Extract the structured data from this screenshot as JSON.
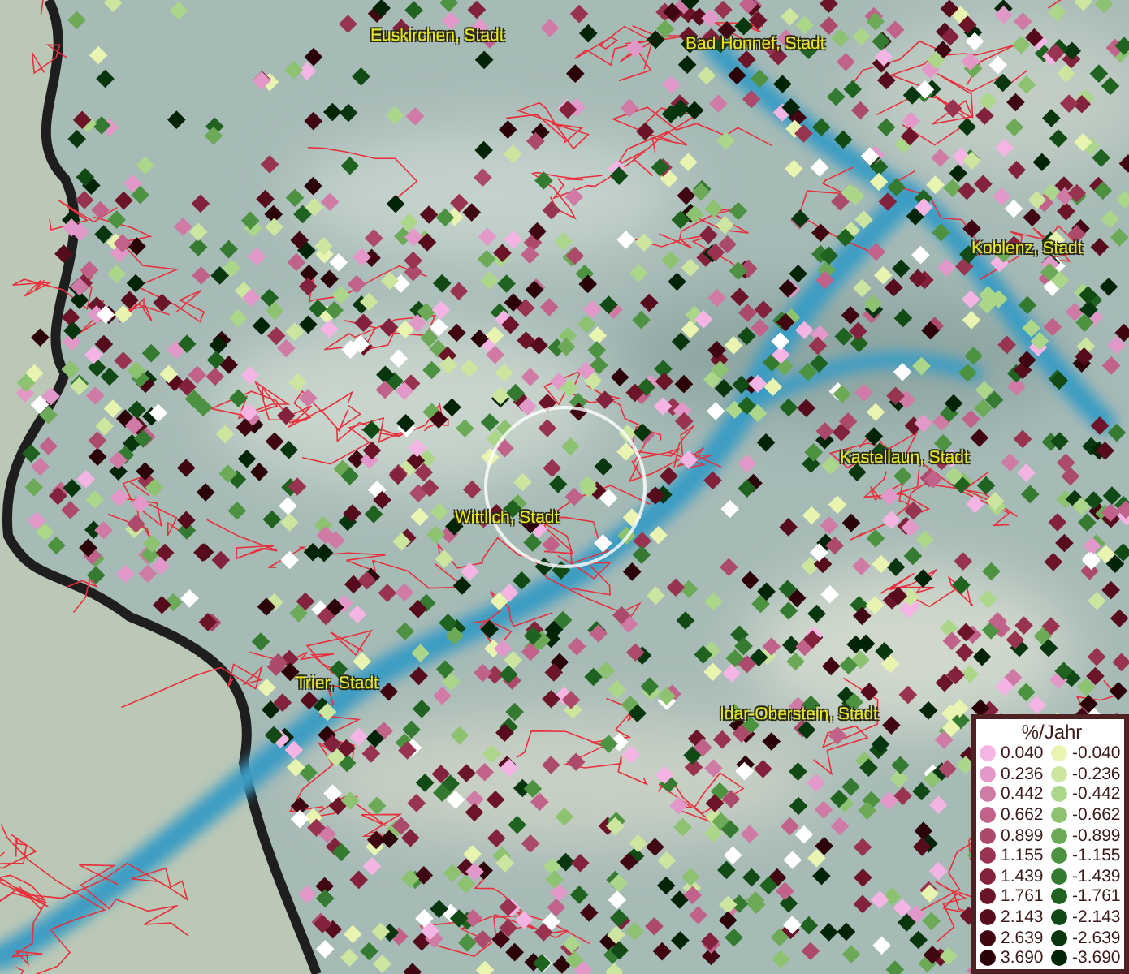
{
  "map": {
    "place_labels": [
      {
        "text": "Euskirchen, Stadt"
      },
      {
        "text": "Bad Honnef, Stadt"
      },
      {
        "text": "Koblenz, Stadt"
      },
      {
        "text": "Kastellaun, Stadt"
      },
      {
        "text": "Wittlich, Stadt"
      },
      {
        "text": "Trier, Stadt"
      },
      {
        "text": "Idar-Oberstein, Stadt"
      }
    ]
  },
  "legend": {
    "title": "%/Jahr",
    "rows": [
      {
        "positive": {
          "label": "0.040",
          "color": "#f4b4e4"
        },
        "negative": {
          "label": "-0.040",
          "color": "#e8f4b0"
        }
      },
      {
        "positive": {
          "label": "0.236",
          "color": "#e298c8"
        },
        "negative": {
          "label": "-0.236",
          "color": "#cce6a0"
        }
      },
      {
        "positive": {
          "label": "0.442",
          "color": "#d07aa6"
        },
        "negative": {
          "label": "-0.442",
          "color": "#acd68a"
        }
      },
      {
        "positive": {
          "label": "0.662",
          "color": "#c0628a"
        },
        "negative": {
          "label": "-0.662",
          "color": "#8cc270"
        }
      },
      {
        "positive": {
          "label": "0.899",
          "color": "#ac4a6c"
        },
        "negative": {
          "label": "-0.899",
          "color": "#6caa58"
        }
      },
      {
        "positive": {
          "label": "1.155",
          "color": "#983450"
        },
        "negative": {
          "label": "-1.155",
          "color": "#4c9240"
        }
      },
      {
        "positive": {
          "label": "1.439",
          "color": "#82223c"
        },
        "negative": {
          "label": "-1.439",
          "color": "#347a30"
        }
      },
      {
        "positive": {
          "label": "1.761",
          "color": "#6c1428"
        },
        "negative": {
          "label": "-1.761",
          "color": "#206220"
        }
      },
      {
        "positive": {
          "label": "2.143",
          "color": "#560c1c"
        },
        "negative": {
          "label": "-2.143",
          "color": "#124a16"
        }
      },
      {
        "positive": {
          "label": "2.639",
          "color": "#400612"
        },
        "negative": {
          "label": "-2.639",
          "color": "#08360e"
        }
      },
      {
        "positive": {
          "label": "3.690",
          "color": "#2a0208"
        },
        "negative": {
          "label": "-3.690",
          "color": "#022406"
        }
      }
    ]
  }
}
